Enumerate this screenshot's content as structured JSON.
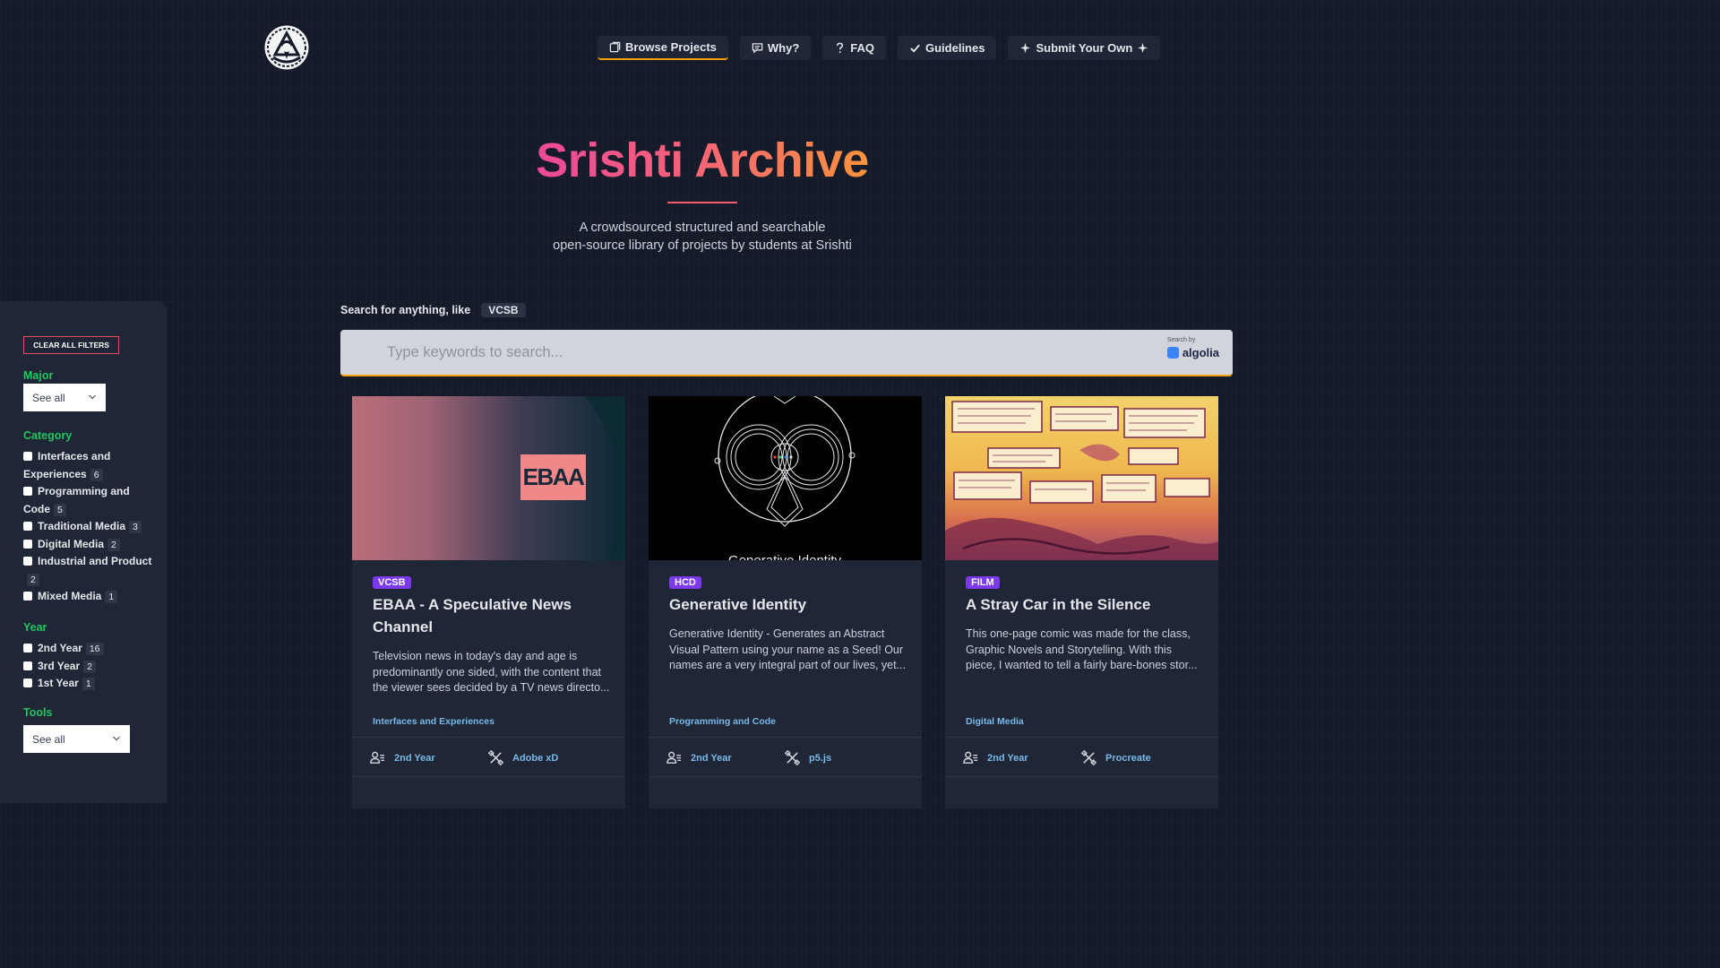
{
  "nav": {
    "items": [
      {
        "label": "Browse Projects",
        "icon": "browse-icon"
      },
      {
        "label": "Why?",
        "icon": "speech-bubble-icon"
      },
      {
        "label": "FAQ",
        "icon": "question-icon"
      },
      {
        "label": "Guidelines",
        "icon": "check-icon"
      },
      {
        "label": "Submit Your Own",
        "icon": "sparkle-icon"
      }
    ]
  },
  "hero": {
    "title": "Srishti Archive",
    "subtitle_line1": "A crowdsourced structured and searchable",
    "subtitle_line2": "open-source library of projects by students at Srishti"
  },
  "search": {
    "hint_label": "Search for anything, like",
    "hint_chip": "VCSB",
    "placeholder": "Type keywords to search...",
    "powered_by": "Search by",
    "provider": "algolia"
  },
  "filters": {
    "clear_label": "CLEAR ALL FILTERS",
    "major": {
      "heading": "Major",
      "selected": "See all"
    },
    "category": {
      "heading": "Category",
      "items": [
        {
          "label": "Interfaces and Experiences",
          "count": "6"
        },
        {
          "label": "Programming and Code",
          "count": "5"
        },
        {
          "label": "Traditional Media",
          "count": "3"
        },
        {
          "label": "Digital Media",
          "count": "2"
        },
        {
          "label": "Industrial and Product",
          "count": "2"
        },
        {
          "label": "Mixed Media",
          "count": "1"
        }
      ]
    },
    "year": {
      "heading": "Year",
      "items": [
        {
          "label": "2nd Year",
          "count": "16"
        },
        {
          "label": "3rd Year",
          "count": "2"
        },
        {
          "label": "1st Year",
          "count": "1"
        }
      ]
    },
    "tools": {
      "heading": "Tools",
      "selected": "See all"
    }
  },
  "cards": [
    {
      "badge": "VCSB",
      "title": "EBAA - A Speculative News Channel",
      "description": "Television news in today's day and age is predominantly one sided, with the content that the viewer sees decided by a TV news directo...",
      "category": "Interfaces and Experiences",
      "year": "2nd Year",
      "tool": "Adobe xD",
      "thumb_logo": "EBAA"
    },
    {
      "badge": "HCD",
      "title": "Generative Identity",
      "description": "Generative Identity - Generates an Abstract Visual Pattern using your name as a Seed! Our names are a very integral part of our lives, yet...",
      "category": "Programming and Code",
      "year": "2nd Year",
      "tool": "p5.js",
      "thumb_caption": "Generative Identity"
    },
    {
      "badge": "FILM",
      "title": "A Stray Car in the Silence",
      "description": "This one-page comic was made for the class, Graphic Novels and Storytelling. With this piece, I wanted to tell a fairly bare-bones stor...",
      "category": "Digital Media",
      "year": "2nd Year",
      "tool": "Procreate"
    }
  ]
}
